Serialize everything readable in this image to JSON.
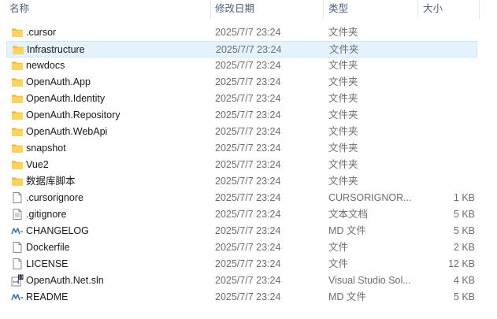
{
  "header": {
    "col_name": "名称",
    "col_date": "修改日期",
    "col_type": "类型",
    "col_size": "大小"
  },
  "files": [
    {
      "name": ".cursor",
      "date": "2025/7/7 23:24",
      "type": "文件夹",
      "size": "",
      "icon": "folder-icon"
    },
    {
      "name": "Infrastructure",
      "date": "2025/7/7 23:24",
      "type": "文件夹",
      "size": "",
      "icon": "folder-icon",
      "hover": true
    },
    {
      "name": "newdocs",
      "date": "2025/7/7 23:24",
      "type": "文件夹",
      "size": "",
      "icon": "folder-icon"
    },
    {
      "name": "OpenAuth.App",
      "date": "2025/7/7 23:24",
      "type": "文件夹",
      "size": "",
      "icon": "folder-icon"
    },
    {
      "name": "OpenAuth.Identity",
      "date": "2025/7/7 23:24",
      "type": "文件夹",
      "size": "",
      "icon": "folder-icon"
    },
    {
      "name": "OpenAuth.Repository",
      "date": "2025/7/7 23:24",
      "type": "文件夹",
      "size": "",
      "icon": "folder-icon"
    },
    {
      "name": "OpenAuth.WebApi",
      "date": "2025/7/7 23:24",
      "type": "文件夹",
      "size": "",
      "icon": "folder-icon"
    },
    {
      "name": "snapshot",
      "date": "2025/7/7 23:24",
      "type": "文件夹",
      "size": "",
      "icon": "folder-icon"
    },
    {
      "name": "Vue2",
      "date": "2025/7/7 23:24",
      "type": "文件夹",
      "size": "",
      "icon": "folder-icon"
    },
    {
      "name": "数据库脚本",
      "date": "2025/7/7 23:24",
      "type": "文件夹",
      "size": "",
      "icon": "folder-icon"
    },
    {
      "name": ".cursorignore",
      "date": "2025/7/7 23:24",
      "type": "CURSORIGNOR...",
      "size": "1 KB",
      "icon": "file-icon"
    },
    {
      "name": ".gitignore",
      "date": "2025/7/7 23:24",
      "type": "文本文档",
      "size": "5 KB",
      "icon": "text-file-icon"
    },
    {
      "name": "CHANGELOG",
      "date": "2025/7/7 23:24",
      "type": "MD 文件",
      "size": "5 KB",
      "icon": "markdown-file-icon"
    },
    {
      "name": "Dockerfile",
      "date": "2025/7/7 23:24",
      "type": "文件",
      "size": "2 KB",
      "icon": "file-icon"
    },
    {
      "name": "LICENSE",
      "date": "2025/7/7 23:24",
      "type": "文件",
      "size": "12 KB",
      "icon": "file-icon"
    },
    {
      "name": "OpenAuth.Net.sln",
      "date": "2025/7/7 23:24",
      "type": "Visual Studio Sol...",
      "size": "4 KB",
      "icon": "visual-studio-solution-icon"
    },
    {
      "name": "README",
      "date": "2025/7/7 23:24",
      "type": "MD 文件",
      "size": "5 KB",
      "icon": "markdown-file-icon"
    }
  ]
}
